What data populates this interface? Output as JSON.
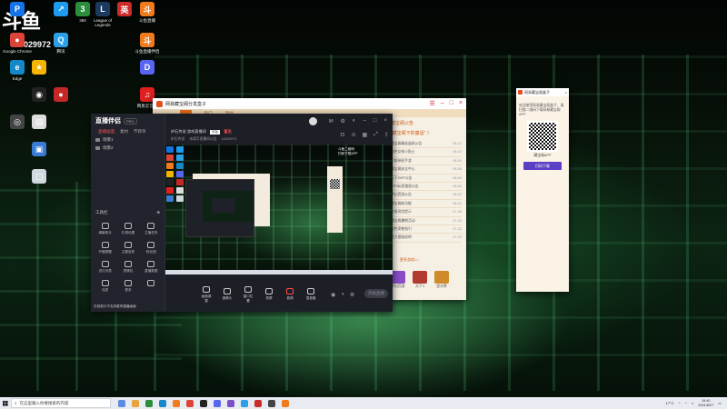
{
  "desktop": {
    "watermark_logo": "斗鱼",
    "watermark_id": "10029972",
    "icons": [
      {
        "label": "",
        "color": "#1473e6",
        "glyph": "P"
      },
      {
        "label": "",
        "color": "#1e9bf0",
        "glyph": "↗"
      },
      {
        "label": "360",
        "color": "#2a8d3c",
        "glyph": "3"
      },
      {
        "label": "League of Legends",
        "color": "#1c3a5e",
        "glyph": "L"
      },
      {
        "label": "",
        "color": "#cc2b2b",
        "glyph": "英"
      },
      {
        "label": "斗鱼直播",
        "color": "#f07a1c",
        "glyph": "斗"
      },
      {
        "label": "Google Chrome",
        "color": "#dc4437",
        "glyph": "●"
      },
      {
        "label": "腾讯",
        "color": "#2aa0e8",
        "glyph": "Q"
      },
      {
        "label": "斗鱼直播伴侣",
        "color": "#f07a1c",
        "glyph": "斗"
      },
      {
        "label": "Edge",
        "color": "#1488c9",
        "glyph": "e"
      },
      {
        "label": "",
        "color": "#f4b400",
        "glyph": "★"
      },
      {
        "label": "",
        "color": "#5865f2",
        "glyph": "D"
      },
      {
        "label": "",
        "color": "#222",
        "glyph": "◉"
      },
      {
        "label": "",
        "color": "#c62828",
        "glyph": "●"
      },
      {
        "label": "网易云音乐",
        "color": "#e02020",
        "glyph": "♫"
      },
      {
        "label": "",
        "color": "#444",
        "glyph": "◎"
      },
      {
        "label": "",
        "color": "#ddd",
        "glyph": "▤"
      },
      {
        "label": "",
        "color": "#3a7bd5",
        "glyph": "▣"
      },
      {
        "label": "",
        "color": "#cfd8dc",
        "glyph": "▢"
      }
    ]
  },
  "back_window": {
    "title": "网易藏宝阁分发盒子",
    "nav": [
      "",
      "热门",
      "活动"
    ],
    "nav_active": 0,
    "heading": "藏宝阁公告",
    "subheading": "“藏宝阁下的童话” ！",
    "news": [
      {
        "text": "藏宝阁精选道具公告",
        "date": "08-12"
      },
      {
        "text": "角色交易小贴士",
        "date": "08-10"
      },
      {
        "text": "正版授权手游",
        "date": "08-09"
      },
      {
        "text": "藏宝阁安全中心",
        "date": "08-08"
      },
      {
        "text": "天下3VIP公告",
        "date": "08-06"
      },
      {
        "text": "CPS玩家激励公告",
        "date": "08-05"
      },
      {
        "text": "梦幻西游公告",
        "date": "08-03"
      },
      {
        "text": "藏宝阁新功能",
        "date": "08-01"
      },
      {
        "text": "交易风险提示",
        "date": "07-28"
      },
      {
        "text": "藏宝阁暑期活动",
        "date": "07-25"
      },
      {
        "text": "角色寄售指引",
        "date": "07-22"
      },
      {
        "text": "官方客服说明",
        "date": "07-20"
      }
    ],
    "more": "更多游戏>>",
    "games": [
      "梦幻西游",
      "天下3",
      "逆水寒"
    ],
    "game_colors": [
      "#8a4dc9",
      "#b23a2f",
      "#d08a2a"
    ]
  },
  "main_window": {
    "app_name": "直播伴侣",
    "version_badge": "PRO",
    "tabs": [
      "直播画面",
      "素材",
      "节目单"
    ],
    "active_tab": 0,
    "scenes": [
      "场景1",
      "场景2"
    ],
    "stream_title": "炉石传说 游戏直播间",
    "tag": "分区",
    "notice": "未填写直播间公告",
    "category": "炉石传说",
    "status": "暂无",
    "room_id": "10029972",
    "tools_heading": "工具栏",
    "tools": [
      "弹幕助手",
      "礼物设置",
      "主播任务",
      "开播提醒",
      "主题皮肤",
      "粉丝团",
      "送礼列表",
      "表情包",
      "直播数据",
      "连麦",
      "更多",
      ""
    ],
    "bottom_tools": [
      "画面调整",
      "摄像头",
      "窗口位置",
      "录屏",
      "音频",
      "混音器"
    ],
    "go_live": "开始直播",
    "footer_note": "在线观众不支持暂停直播画面",
    "preview_text": [
      "斗鱼二维码",
      "扫码下载APP"
    ]
  },
  "qr_window": {
    "title": "网易藏宝阁盒子",
    "description": "欢迎使用网易藏宝阁盒子，请扫描二维码下载网易藏宝阁APP",
    "app_label": "藏宝阁APP",
    "download": "扫码下载"
  },
  "taskbar": {
    "search_placeholder": "在这里输入你要搜索的内容",
    "apps": [
      "#5a8de0",
      "#e8a33a",
      "#2a8d3c",
      "#1488c9",
      "#f07a1c",
      "#dc4437",
      "#222",
      "#5865f2",
      "#7b4fc9",
      "#2aa0e8",
      "#cc2b2b",
      "#444",
      "#f07a1c"
    ],
    "weather": "17°C",
    "time": "19:40",
    "date": "2021/8/27"
  }
}
